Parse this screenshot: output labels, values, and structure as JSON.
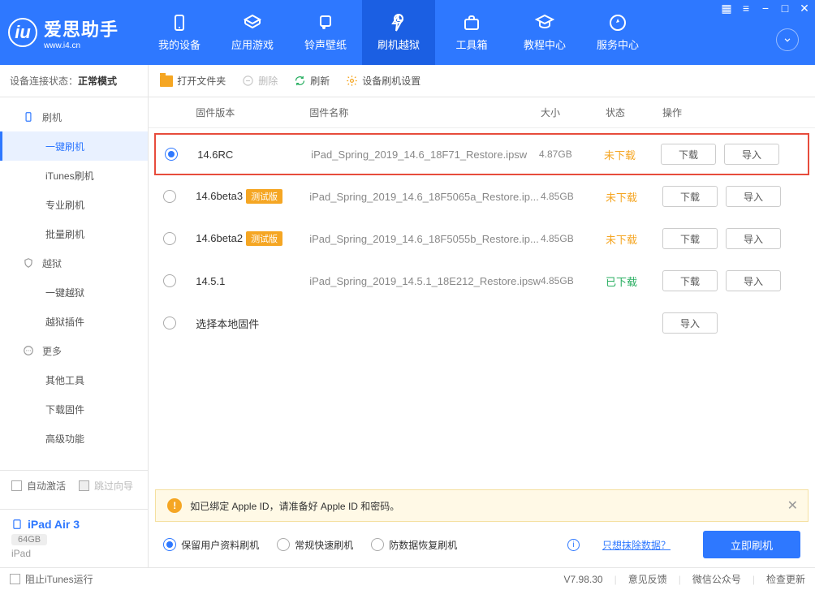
{
  "logo": {
    "title": "爱思助手",
    "subtitle": "www.i4.cn"
  },
  "nav": [
    {
      "label": "我的设备",
      "icon": "device"
    },
    {
      "label": "应用游戏",
      "icon": "apps"
    },
    {
      "label": "铃声壁纸",
      "icon": "music"
    },
    {
      "label": "刷机越狱",
      "icon": "flash",
      "active": true
    },
    {
      "label": "工具箱",
      "icon": "toolbox"
    },
    {
      "label": "教程中心",
      "icon": "tutorial"
    },
    {
      "label": "服务中心",
      "icon": "service"
    }
  ],
  "conn": {
    "label": "设备连接状态：",
    "value": "正常模式"
  },
  "side": [
    {
      "type": "group",
      "label": "刷机",
      "icon": "flash"
    },
    {
      "type": "item",
      "label": "一键刷机",
      "active": true
    },
    {
      "type": "item",
      "label": "iTunes刷机"
    },
    {
      "type": "item",
      "label": "专业刷机"
    },
    {
      "type": "item",
      "label": "批量刷机"
    },
    {
      "type": "group",
      "label": "越狱",
      "icon": "shield"
    },
    {
      "type": "item",
      "label": "一键越狱"
    },
    {
      "type": "item",
      "label": "越狱插件"
    },
    {
      "type": "group",
      "label": "更多",
      "icon": "more"
    },
    {
      "type": "item",
      "label": "其他工具"
    },
    {
      "type": "item",
      "label": "下载固件"
    },
    {
      "type": "item",
      "label": "高级功能"
    }
  ],
  "sideBottom": {
    "autoActivate": "自动激活",
    "skipGuide": "跳过向导"
  },
  "device": {
    "name": "iPad Air 3",
    "storage": "64GB",
    "type": "iPad"
  },
  "toolbar": {
    "openFolder": "打开文件夹",
    "delete": "删除",
    "refresh": "刷新",
    "settings": "设备刷机设置"
  },
  "columns": {
    "version": "固件版本",
    "name": "固件名称",
    "size": "大小",
    "status": "状态",
    "ops": "操作"
  },
  "rows": [
    {
      "selected": true,
      "version": "14.6RC",
      "beta": false,
      "name": "iPad_Spring_2019_14.6_18F71_Restore.ipsw",
      "size": "4.87GB",
      "status": "未下载",
      "statusClass": "not",
      "ops": [
        "下载",
        "导入"
      ],
      "highlighted": true
    },
    {
      "selected": false,
      "version": "14.6beta3",
      "beta": true,
      "betaText": "测试版",
      "name": "iPad_Spring_2019_14.6_18F5065a_Restore.ip...",
      "size": "4.85GB",
      "status": "未下载",
      "statusClass": "not",
      "ops": [
        "下载",
        "导入"
      ]
    },
    {
      "selected": false,
      "version": "14.6beta2",
      "beta": true,
      "betaText": "测试版",
      "name": "iPad_Spring_2019_14.6_18F5055b_Restore.ip...",
      "size": "4.85GB",
      "status": "未下载",
      "statusClass": "not",
      "ops": [
        "下载",
        "导入"
      ]
    },
    {
      "selected": false,
      "version": "14.5.1",
      "beta": false,
      "name": "iPad_Spring_2019_14.5.1_18E212_Restore.ipsw",
      "size": "4.85GB",
      "status": "已下载",
      "statusClass": "done",
      "ops": [
        "下载",
        "导入"
      ]
    },
    {
      "selected": false,
      "version": "选择本地固件",
      "beta": false,
      "name": "",
      "size": "",
      "status": "",
      "statusClass": "",
      "ops": [
        "导入"
      ]
    }
  ],
  "warning": "如已绑定 Apple ID，请准备好 Apple ID 和密码。",
  "flashOpts": [
    {
      "label": "保留用户资料刷机",
      "checked": true
    },
    {
      "label": "常规快速刷机",
      "checked": false
    },
    {
      "label": "防数据恢复刷机",
      "checked": false
    }
  ],
  "eraseLink": "只想抹除数据？",
  "flashBtn": "立即刷机",
  "statusBar": {
    "preventItunes": "阻止iTunes运行",
    "version": "V7.98.30",
    "feedback": "意见反馈",
    "wechat": "微信公众号",
    "checkUpdate": "检查更新"
  }
}
